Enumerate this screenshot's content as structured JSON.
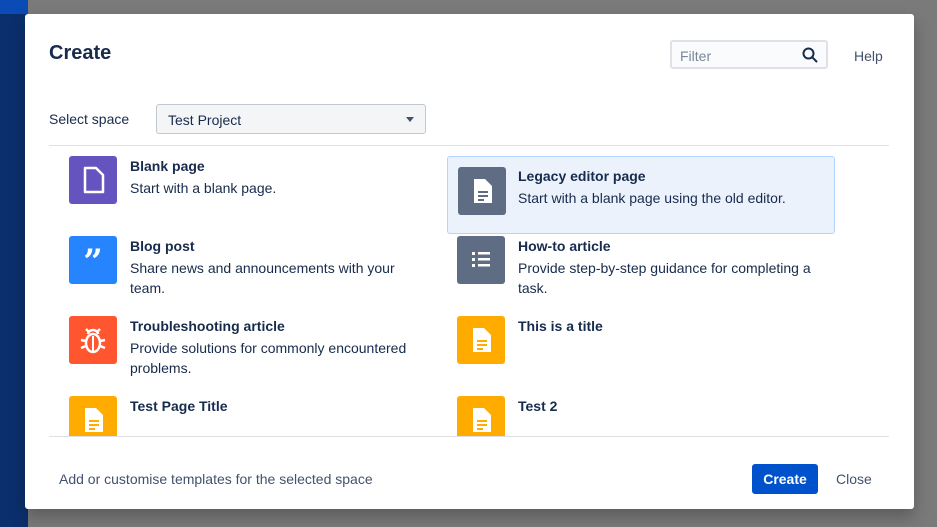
{
  "dialog": {
    "title": "Create",
    "filter_placeholder": "Filter",
    "help_label": "Help",
    "select_space_label": "Select space",
    "selected_space": "Test Project",
    "footer_link": "Add or customise templates for the selected space",
    "create_button": "Create",
    "close_button": "Close"
  },
  "templates": [
    {
      "name": "Blank page",
      "desc": "Start with a blank page.",
      "icon": "blank-page-icon",
      "color": "#6554c0",
      "selected": false
    },
    {
      "name": "Legacy editor page",
      "desc": "Start with a blank page using the old editor.",
      "icon": "legacy-page-icon",
      "color": "#5e6c84",
      "selected": true
    },
    {
      "name": "Blog post",
      "desc": "Share news and announcements with your team.",
      "icon": "quote-icon",
      "color": "#2684ff",
      "selected": false
    },
    {
      "name": "How-to article",
      "desc": "Provide step-by-step guidance for completing a task.",
      "icon": "list-icon",
      "color": "#5e6c84",
      "selected": false
    },
    {
      "name": "Troubleshooting article",
      "desc": "Provide solutions for commonly encountered problems.",
      "icon": "bug-icon",
      "color": "#ff5630",
      "selected": false
    },
    {
      "name": "This is a title",
      "desc": "",
      "icon": "page-icon",
      "color": "#ffab00",
      "selected": false
    },
    {
      "name": "Test Page Title",
      "desc": "",
      "icon": "page-icon",
      "color": "#ffab00",
      "selected": false
    },
    {
      "name": "Test 2",
      "desc": "",
      "icon": "page-icon",
      "color": "#ffab00",
      "selected": false
    }
  ],
  "colors": {
    "primary": "#0052cc",
    "selected_bg": "#ebf2fb",
    "text": "#172b4d"
  }
}
